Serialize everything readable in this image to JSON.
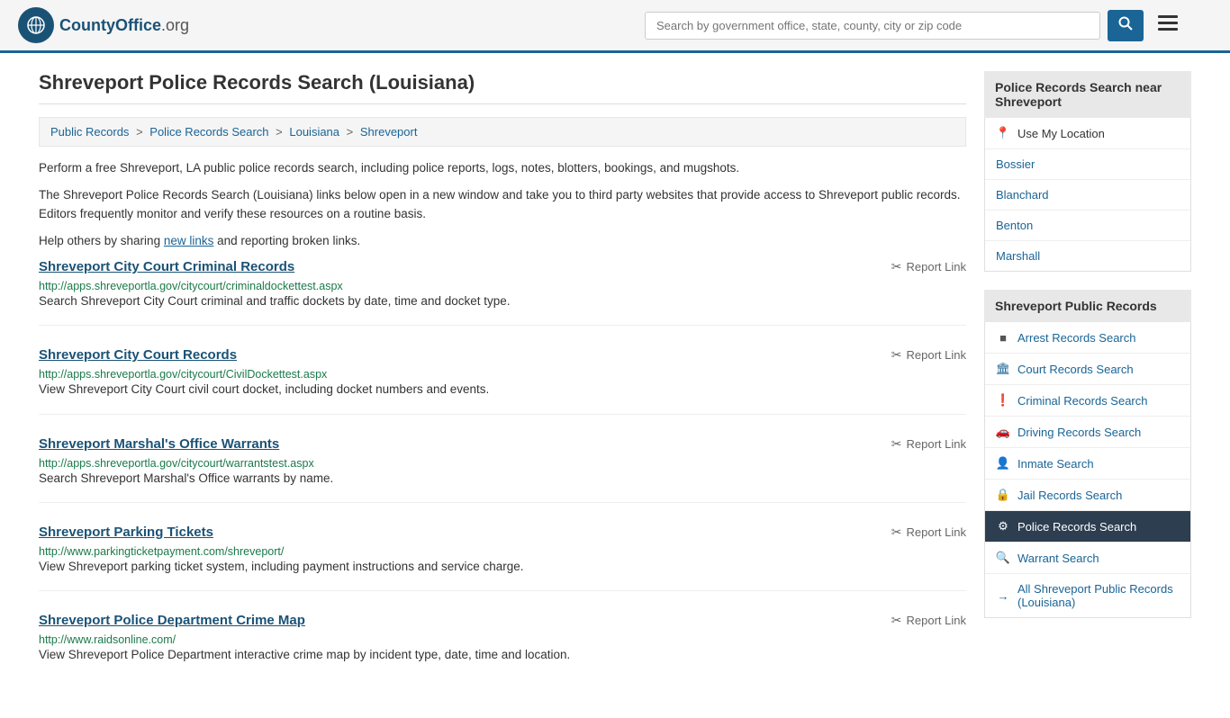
{
  "header": {
    "logo_icon": "🌐",
    "logo_name": "CountyOffice",
    "logo_ext": ".org",
    "search_placeholder": "Search by government office, state, county, city or zip code",
    "search_button_icon": "🔍",
    "menu_icon": "≡"
  },
  "page": {
    "title": "Shreveport Police Records Search (Louisiana)",
    "breadcrumbs": [
      {
        "label": "Public Records",
        "href": "#"
      },
      {
        "label": "Police Records Search",
        "href": "#"
      },
      {
        "label": "Louisiana",
        "href": "#"
      },
      {
        "label": "Shreveport",
        "href": "#"
      }
    ],
    "intro1": "Perform a free Shreveport, LA public police records search, including police reports, logs, notes, blotters, bookings, and mugshots.",
    "intro2": "The Shreveport Police Records Search (Louisiana) links below open in a new window and take you to third party websites that provide access to Shreveport public records. Editors frequently monitor and verify these resources on a routine basis.",
    "intro3_prefix": "Help others by sharing ",
    "intro3_link": "new links",
    "intro3_suffix": " and reporting broken links."
  },
  "results": [
    {
      "title": "Shreveport City Court Criminal Records",
      "url": "http://apps.shreveportla.gov/citycourt/criminaldockettest.aspx",
      "description": "Search Shreveport City Court criminal and traffic dockets by date, time and docket type.",
      "report_label": "Report Link"
    },
    {
      "title": "Shreveport City Court Records",
      "url": "http://apps.shreveportla.gov/citycourt/CivilDockettest.aspx",
      "description": "View Shreveport City Court civil court docket, including docket numbers and events.",
      "report_label": "Report Link"
    },
    {
      "title": "Shreveport Marshal's Office Warrants",
      "url": "http://apps.shreveportla.gov/citycourt/warrantstest.aspx",
      "description": "Search Shreveport Marshal's Office warrants by name.",
      "report_label": "Report Link"
    },
    {
      "title": "Shreveport Parking Tickets",
      "url": "http://www.parkingticketpayment.com/shreveport/",
      "description": "View Shreveport parking ticket system, including payment instructions and service charge.",
      "report_label": "Report Link"
    },
    {
      "title": "Shreveport Police Department Crime Map",
      "url": "http://www.raidsonline.com/",
      "description": "View Shreveport Police Department interactive crime map by incident type, date, time and location.",
      "report_label": "Report Link"
    }
  ],
  "sidebar": {
    "nearby_heading": "Police Records Search near Shreveport",
    "use_location_label": "Use My Location",
    "nearby_cities": [
      {
        "label": "Bossier",
        "href": "#"
      },
      {
        "label": "Blanchard",
        "href": "#"
      },
      {
        "label": "Benton",
        "href": "#"
      },
      {
        "label": "Marshall",
        "href": "#"
      }
    ],
    "public_records_heading": "Shreveport Public Records",
    "public_records_items": [
      {
        "label": "Arrest Records Search",
        "icon": "■",
        "active": false
      },
      {
        "label": "Court Records Search",
        "icon": "🏛",
        "active": false
      },
      {
        "label": "Criminal Records Search",
        "icon": "❗",
        "active": false
      },
      {
        "label": "Driving Records Search",
        "icon": "🚗",
        "active": false
      },
      {
        "label": "Inmate Search",
        "icon": "👤",
        "active": false
      },
      {
        "label": "Jail Records Search",
        "icon": "🔒",
        "active": false
      },
      {
        "label": "Police Records Search",
        "icon": "⚙",
        "active": true
      },
      {
        "label": "Warrant Search",
        "icon": "🔍",
        "active": false
      },
      {
        "label": "All Shreveport Public Records (Louisiana)",
        "icon": "→",
        "active": false
      }
    ]
  }
}
